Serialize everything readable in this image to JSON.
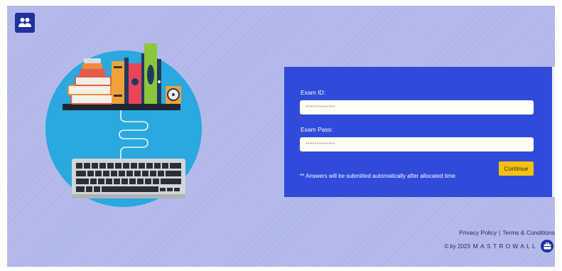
{
  "header": {
    "logo_icon": "users-icon",
    "logo_color": "#1f2f9c"
  },
  "illustration": {
    "subject": "books-shelf-keyboard"
  },
  "login_form": {
    "exam_id_label": "Exam ID:",
    "exam_id_placeholder": "*************",
    "exam_pass_label": "Exam Pass:",
    "exam_pass_placeholder": "*************",
    "notice": "** Answers will be submitted automatically after allocated time",
    "continue_label": "Continue",
    "panel_color": "#2f4bd9",
    "button_color": "#f4c20d"
  },
  "footer": {
    "privacy_label": "Privacy Policy",
    "separator": "|",
    "terms_label": "Terms & Conditions",
    "copyright_prefix": "© by 2023",
    "brand_name": "MASTROWALL",
    "brand_icon": "briefcase-icon"
  }
}
